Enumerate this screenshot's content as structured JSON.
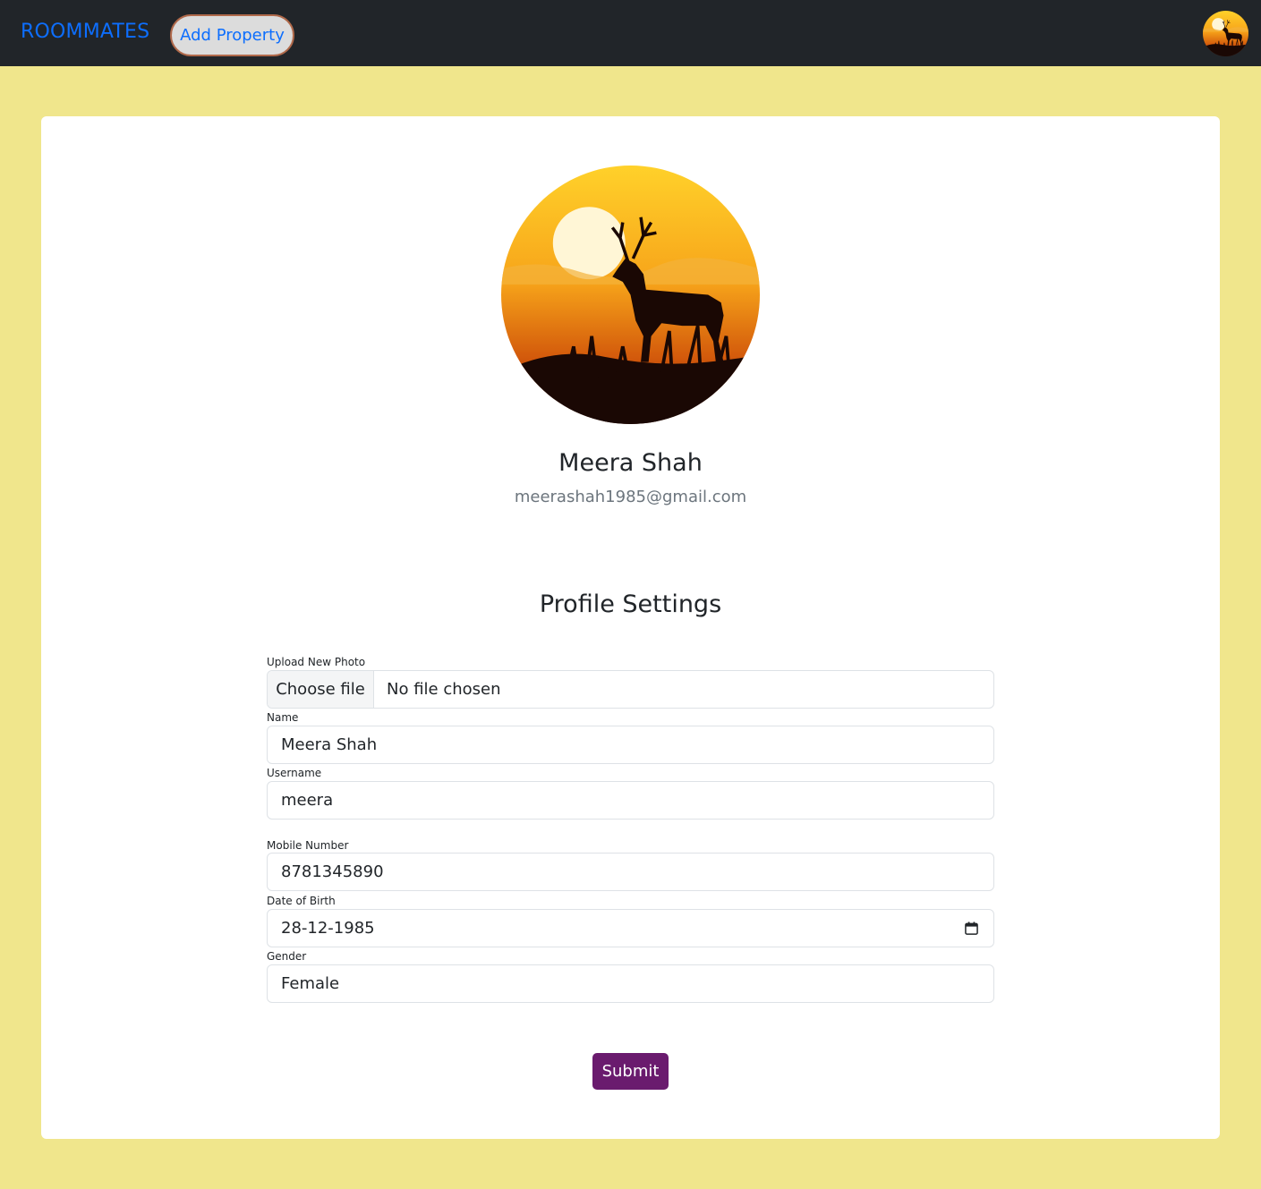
{
  "navbar": {
    "brand": "ROOMMATES",
    "add_property_label": "Add Property",
    "avatar_icon": "deer-sunset-avatar"
  },
  "profile": {
    "name": "Meera Shah",
    "email": "meerashah1985@gmail.com",
    "picture_icon": "deer-sunset-avatar"
  },
  "settings": {
    "title": "Profile Settings",
    "upload": {
      "label": "Upload New Photo",
      "button": "Choose file",
      "status": "No file chosen"
    },
    "name": {
      "label": "Name",
      "value": "Meera Shah"
    },
    "username": {
      "label": "Username",
      "value": "meera"
    },
    "mobile": {
      "label": "Mobile Number",
      "value": "8781345890"
    },
    "dob": {
      "label": "Date of Birth",
      "value": "28-12-1985",
      "icon": "calendar-icon"
    },
    "gender": {
      "label": "Gender",
      "value": "Female"
    },
    "submit_label": "Submit"
  },
  "colors": {
    "page_background": "#f0e68c",
    "navbar_background": "#212529",
    "brand_color": "#0d6efd",
    "submit_background": "#6a1b6e",
    "muted_text": "#6c757d"
  }
}
